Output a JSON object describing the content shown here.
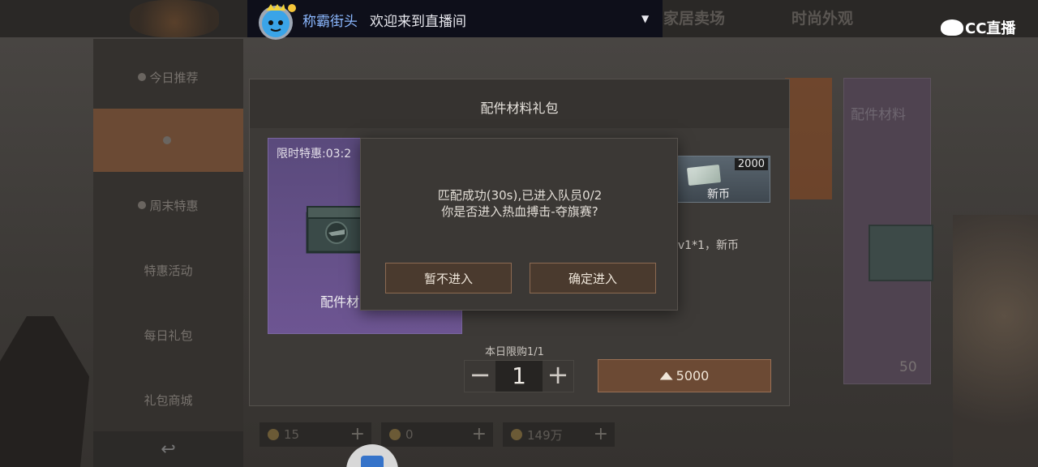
{
  "overlay": {
    "streamer_name": "称霸街头",
    "welcome_text": "欢迎来到直播间",
    "dropdown_glyph": "▼",
    "platform_logo": "CC直播"
  },
  "background": {
    "top_tabs": [
      "家居卖场",
      "时尚外观"
    ],
    "side_menu": [
      "今日推荐",
      "",
      "周末特惠",
      "特惠活动",
      "每日礼包",
      "礼包商城"
    ],
    "right_card": {
      "title": "配件材料",
      "price": "50"
    },
    "currencies": [
      {
        "amount": "15"
      },
      {
        "amount": "0"
      },
      {
        "amount": "149万"
      }
    ]
  },
  "panel": {
    "title": "配件材料礼包",
    "item": {
      "timer": "限时特惠:03:2",
      "name": "配件材"
    },
    "reward": {
      "badge": "2000",
      "label": "新币"
    },
    "description": "料lv1*1，新币",
    "daily_limit": "本日限购1/1",
    "quantity": "1",
    "minus": "−",
    "plus": "+",
    "price": "5000"
  },
  "dialog": {
    "line1": "匹配成功(30s),已进入队员0/2",
    "line2": "你是否进入热血搏击-夺旗赛?",
    "cancel_label": "暂不进入",
    "confirm_label": "确定进入"
  }
}
